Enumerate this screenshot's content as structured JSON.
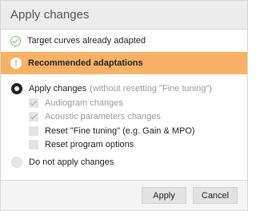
{
  "dialog": {
    "title": "Apply changes",
    "status_text": "Target curves already adapted",
    "warning_text": "Recommended adaptations",
    "warning_icon_glyph": "!",
    "options": {
      "apply": {
        "label": "Apply changes",
        "hint": "(without resetting \"Fine tuning\")",
        "selected": true
      },
      "checks": [
        {
          "label": "Audiogram changes",
          "checked": true,
          "disabled": true
        },
        {
          "label": "Acoustic parameters changes",
          "checked": true,
          "disabled": true
        },
        {
          "label": "Reset \"Fine tuning\" (e.g. Gain & MPO)",
          "checked": false,
          "disabled": false
        },
        {
          "label": "Reset program options",
          "checked": false,
          "disabled": false
        }
      ],
      "do_not_apply": {
        "label": "Do not apply changes",
        "selected": false
      }
    },
    "buttons": {
      "apply_label": "Apply",
      "cancel_label": "Cancel"
    }
  },
  "colors": {
    "warning_bg": "#f7b267",
    "check_green": "#8cc063",
    "ok_green": "#7cc24a"
  }
}
